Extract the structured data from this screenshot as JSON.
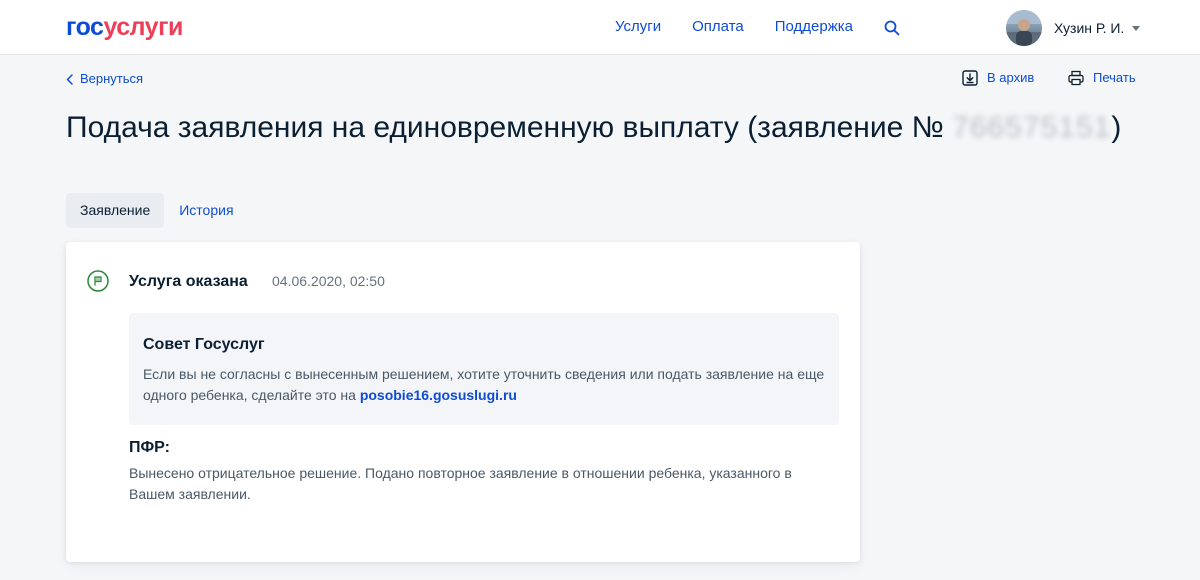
{
  "header": {
    "logo_part1": "гос",
    "logo_part2": "услуги",
    "nav": [
      "Услуги",
      "Оплата",
      "Поддержка"
    ],
    "user_name": "Хузин Р. И."
  },
  "toolbar": {
    "back_label": "Вернуться",
    "archive_label": "В архив",
    "print_label": "Печать"
  },
  "page": {
    "title": "Подача заявления на единовременную выплату (заявление №",
    "application_number_blurred": "766575151",
    "title_close": ")"
  },
  "tabs": [
    {
      "label": "Заявление",
      "active": true
    },
    {
      "label": "История",
      "active": false
    }
  ],
  "status": {
    "title": "Услуга оказана",
    "date": "04.06.2020, 02:50",
    "color": "#2c8637"
  },
  "advice": {
    "title": "Совет Госуслуг",
    "text": "Если вы не согласны с вынесенным решением, хотите уточнить сведения или подать заявление на еще одного ребенка, сделайте это на ",
    "link": "posobie16.gosuslugi.ru"
  },
  "pfr": {
    "title": "ПФР:",
    "text": "Вынесено отрицательное решение. Подано повторное заявление в отношении ребенка, указанного в Вашем заявлении."
  },
  "colors": {
    "brand_blue": "#0d4cd3",
    "brand_red": "#ee3f58",
    "text": "#0b1f33"
  }
}
